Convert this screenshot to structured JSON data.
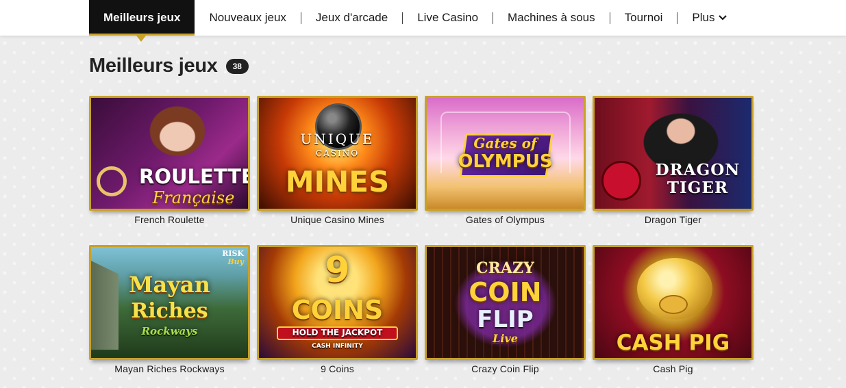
{
  "nav": {
    "tabs": [
      {
        "label": "Meilleurs jeux",
        "active": true
      },
      {
        "label": "Nouveaux jeux"
      },
      {
        "label": "Jeux d'arcade"
      },
      {
        "label": "Live Casino"
      },
      {
        "label": "Machines à sous"
      },
      {
        "label": "Tournoi"
      },
      {
        "label": "Plus"
      }
    ],
    "more_icon": "chevron-down-icon",
    "accent_color": "#c9a227"
  },
  "section": {
    "title": "Meilleurs jeux",
    "count": "38"
  },
  "games": [
    {
      "name": "French Roulette",
      "art": {
        "line1": "ROULETTE",
        "line2": "Française"
      }
    },
    {
      "name": "Unique Casino Mines",
      "art": {
        "line1": "UNIQUE",
        "line2": "CASINO",
        "line3": "MINES"
      }
    },
    {
      "name": "Gates of Olympus",
      "art": {
        "line1": "Gates of",
        "line2": "OLYMPUS"
      }
    },
    {
      "name": "Dragon Tiger",
      "art": {
        "line1": "DRAGON",
        "line2": "TIGER"
      }
    },
    {
      "name": "Mayan Riches Rockways",
      "art": {
        "line1": "Mayan",
        "line2": "Riches",
        "line3": "Rockways",
        "badge1": "RISK",
        "badge2": "Buy"
      }
    },
    {
      "name": "9 Coins",
      "art": {
        "line1": "9",
        "line2": "COINS",
        "line3": "HOLD THE JACKPOT",
        "line4": "CASH INFINITY"
      }
    },
    {
      "name": "Crazy Coin Flip",
      "art": {
        "line1": "CRAZY",
        "line2": "COIN",
        "line3": "FLIP",
        "line4": "Live"
      }
    },
    {
      "name": "Cash Pig",
      "art": {
        "line1": "CASH PIG"
      }
    }
  ]
}
